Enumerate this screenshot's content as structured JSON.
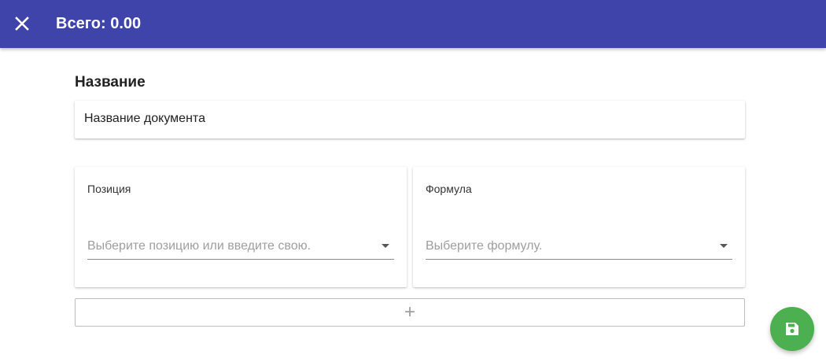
{
  "appbar": {
    "title": "Всего: 0.00",
    "close_icon": "close-icon",
    "color": "#3f44ab"
  },
  "name_section": {
    "label": "Название",
    "input_placeholder": "Название документа",
    "input_value": ""
  },
  "position_field": {
    "label": "Позиция",
    "placeholder": "Выберите позицию или введите свою.",
    "icon": "dropdown-arrow-icon"
  },
  "formula_field": {
    "label": "Формула",
    "placeholder": "Выберите формулу.",
    "icon": "dropdown-arrow-icon"
  },
  "add_button": {
    "icon": "plus-icon",
    "glyph": "+"
  },
  "fab": {
    "icon": "save-icon",
    "color": "#4caf50"
  }
}
